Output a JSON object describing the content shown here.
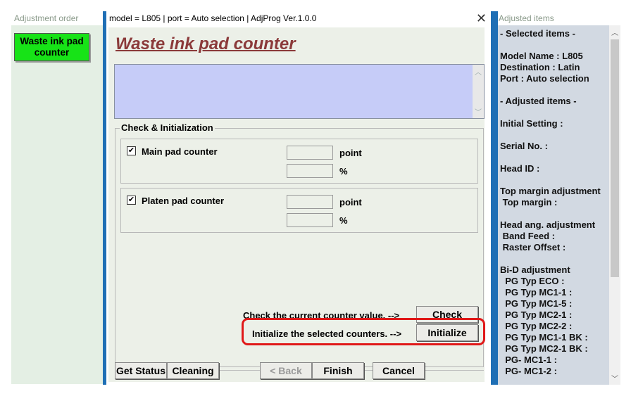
{
  "left_pane": {
    "title": "Adjustment order",
    "button": "Waste ink pad counter"
  },
  "window": {
    "title": "model = L805 | port = Auto selection | AdjProg Ver.1.0.0",
    "close": "✕",
    "heading": "Waste ink pad counter",
    "group_label": "Check & Initialization",
    "main_pad": {
      "checked": "✔",
      "label": "Main pad counter",
      "unit1": "point",
      "unit2": "%"
    },
    "platen_pad": {
      "checked": "✔",
      "label": "Platen pad counter",
      "unit1": "point",
      "unit2": "%"
    },
    "check_text": "Check the current counter value. -->",
    "check_button": "Check",
    "init_text": "Initialize the selected counters. -->",
    "init_button": "Initialize",
    "bottom": {
      "get_status": "Get Status",
      "cleaning": "Cleaning",
      "back": "< Back",
      "finish": "Finish",
      "cancel": "Cancel"
    }
  },
  "right_pane": {
    "title": "Adjusted items",
    "lines": [
      "- Selected items -",
      "",
      "Model Name : L805",
      "Destination : Latin",
      "Port : Auto selection",
      "",
      "- Adjusted items -",
      "",
      "Initial Setting :",
      "",
      "Serial No. :",
      "",
      "Head ID :",
      "",
      "Top margin adjustment",
      " Top margin :",
      "",
      "Head ang. adjustment",
      " Band Feed :",
      " Raster Offset :",
      "",
      "Bi-D adjustment",
      "  PG Typ ECO :",
      "  PG Typ MC1-1 :",
      "  PG Typ MC1-5 :",
      "  PG Typ MC2-1 :",
      "  PG Typ MC2-2 :",
      "  PG Typ MC1-1 BK :",
      "  PG Typ MC2-1 BK :",
      "  PG- MC1-1 :",
      "  PG- MC1-2 :"
    ]
  }
}
